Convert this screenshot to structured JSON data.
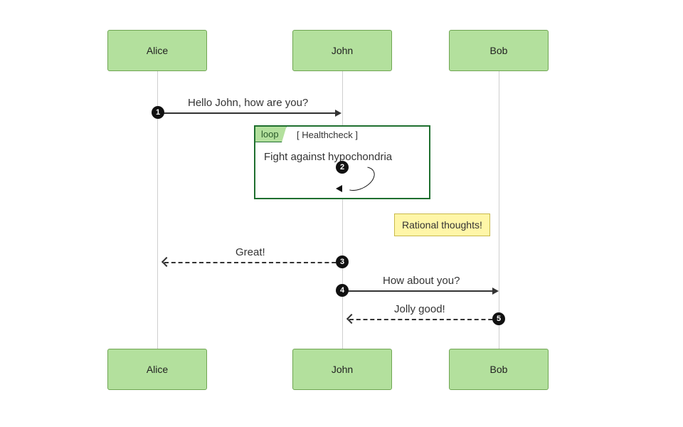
{
  "participants": [
    "Alice",
    "John",
    "Bob"
  ],
  "loop": {
    "keyword": "loop",
    "condition": "[ Healthcheck ]",
    "body": "Fight against hypochondria"
  },
  "note": "Rational thoughts!",
  "messages": {
    "m1": {
      "seq": "1",
      "text": "Hello John, how are you?"
    },
    "m2": {
      "seq": "2",
      "text": ""
    },
    "m3": {
      "seq": "3",
      "text": "Great!"
    },
    "m4": {
      "seq": "4",
      "text": "How about you?"
    },
    "m5": {
      "seq": "5",
      "text": "Jolly good!"
    }
  },
  "chart_data": {
    "type": "sequence-diagram",
    "participants": [
      "Alice",
      "John",
      "Bob"
    ],
    "events": [
      {
        "seq": 1,
        "from": "Alice",
        "to": "John",
        "text": "Hello John, how are you?",
        "style": "solid"
      },
      {
        "fragment": "loop",
        "condition": "Healthcheck",
        "events": [
          {
            "seq": 2,
            "from": "John",
            "to": "John",
            "text": "Fight against hypochondria",
            "style": "solid"
          }
        ]
      },
      {
        "note": "Rational thoughts!",
        "over": "John",
        "side": "right"
      },
      {
        "seq": 3,
        "from": "John",
        "to": "Alice",
        "text": "Great!",
        "style": "dashed"
      },
      {
        "seq": 4,
        "from": "John",
        "to": "Bob",
        "text": "How about you?",
        "style": "solid"
      },
      {
        "seq": 5,
        "from": "Bob",
        "to": "John",
        "text": "Jolly good!",
        "style": "dashed"
      }
    ]
  }
}
